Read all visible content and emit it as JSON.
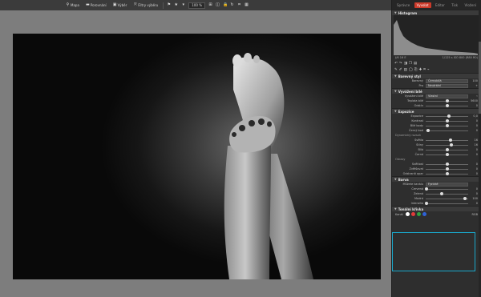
{
  "toolbar": {
    "map_label": "Mapa",
    "compare_label": "Porovnání",
    "selection_label": "Výběr",
    "filters_label": "Filtry výběru",
    "zoom": "100 %"
  },
  "mode_tabs": [
    "Správce",
    "Vyvolat",
    "Editor",
    "Tisk",
    "Vložení"
  ],
  "active_mode": "Vyvolat",
  "histogram": {
    "title": "Histogram",
    "left_info": "ƒ/6  16 E",
    "right_info": "1/125 s  ISO 800  (R80 R0)"
  },
  "sections": {
    "styl": {
      "title": "Barevný styl",
      "style_label": "Barevný",
      "style_value": "Černobílá",
      "profile_label": "Pro",
      "profile_value": "Neutrální",
      "amount_value": "100"
    },
    "wb": {
      "title": "Vyvážení bílé",
      "mode_label": "Vyvážení bílé",
      "mode_value": "Vlastní",
      "rows": [
        {
          "label": "Teplota bílé",
          "value": "5600",
          "pos": 0.5
        },
        {
          "label": "Odstín",
          "value": "0",
          "pos": 0.5
        }
      ]
    },
    "exp": {
      "title": "Expozice",
      "rows": [
        {
          "label": "Expozice",
          "value": "0,0",
          "pos": 0.55
        },
        {
          "label": "Kontrast",
          "value": "0",
          "pos": 0.5
        },
        {
          "label": "Bílé body",
          "value": "0",
          "pos": 0.5
        },
        {
          "label": "Černý bod",
          "value": "0",
          "pos": 0.05
        }
      ],
      "dyn_label": "Dynamický rozsah",
      "dyn_rows": [
        {
          "label": "Světla",
          "value": "16",
          "pos": 0.58
        },
        {
          "label": "Stíny",
          "value": "16",
          "pos": 0.6
        },
        {
          "label": "Bílá",
          "value": "0",
          "pos": 0.5
        },
        {
          "label": "Černá",
          "value": "0",
          "pos": 0.5
        }
      ],
      "tones_label": "Obrazy",
      "tone_rows": [
        {
          "label": "Světlost",
          "value": "0",
          "pos": 0.5
        },
        {
          "label": "Zvětšovat",
          "value": "0",
          "pos": 0.5
        },
        {
          "label": "Odstranit opar",
          "value": "0",
          "pos": 0.5
        }
      ]
    },
    "barva": {
      "title": "Barva",
      "method_label": "Můžete kanálu",
      "method_value": "Fyzické",
      "rows": [
        {
          "label": "Červená",
          "value": "0",
          "pos": 0.02
        },
        {
          "label": "Zelená",
          "value": "0",
          "pos": 0.38
        },
        {
          "label": "Modrá",
          "value": "100",
          "pos": 0.92
        },
        {
          "label": "Intenzita",
          "value": "0",
          "pos": 0.02
        }
      ]
    },
    "tonal": {
      "title": "Tonální křivka",
      "channel_label": "Kanál",
      "rgb_label": "RGB",
      "channel_colors": [
        "#ffffff",
        "#e23b3b",
        "#2fa23f",
        "#2f63d6"
      ]
    }
  }
}
